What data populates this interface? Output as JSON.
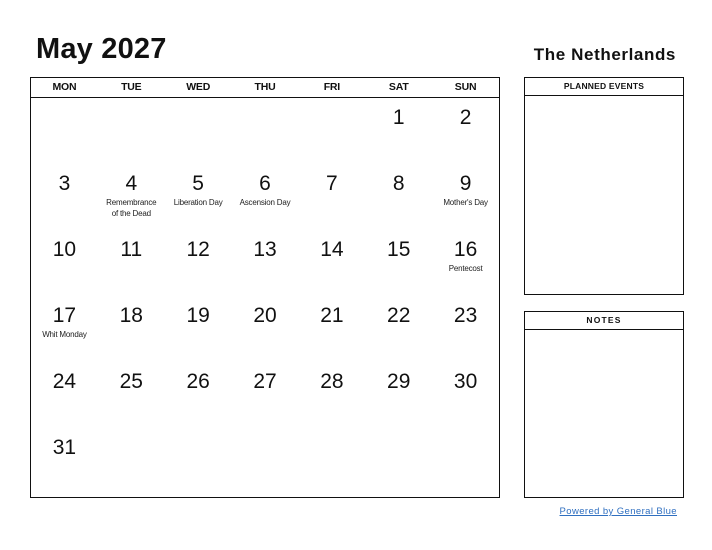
{
  "header": {
    "title": "May 2027",
    "country": "The Netherlands"
  },
  "calendar": {
    "weekdays": [
      "MON",
      "TUE",
      "WED",
      "THU",
      "FRI",
      "SAT",
      "SUN"
    ],
    "weeks": [
      [
        {
          "day": "",
          "holiday": ""
        },
        {
          "day": "",
          "holiday": ""
        },
        {
          "day": "",
          "holiday": ""
        },
        {
          "day": "",
          "holiday": ""
        },
        {
          "day": "",
          "holiday": ""
        },
        {
          "day": "1",
          "holiday": ""
        },
        {
          "day": "2",
          "holiday": ""
        }
      ],
      [
        {
          "day": "3",
          "holiday": ""
        },
        {
          "day": "4",
          "holiday": "Remembrance of the Dead"
        },
        {
          "day": "5",
          "holiday": "Liberation Day"
        },
        {
          "day": "6",
          "holiday": "Ascension Day"
        },
        {
          "day": "7",
          "holiday": ""
        },
        {
          "day": "8",
          "holiday": ""
        },
        {
          "day": "9",
          "holiday": "Mother's Day"
        }
      ],
      [
        {
          "day": "10",
          "holiday": ""
        },
        {
          "day": "11",
          "holiday": ""
        },
        {
          "day": "12",
          "holiday": ""
        },
        {
          "day": "13",
          "holiday": ""
        },
        {
          "day": "14",
          "holiday": ""
        },
        {
          "day": "15",
          "holiday": ""
        },
        {
          "day": "16",
          "holiday": "Pentecost"
        }
      ],
      [
        {
          "day": "17",
          "holiday": "Whit Monday"
        },
        {
          "day": "18",
          "holiday": ""
        },
        {
          "day": "19",
          "holiday": ""
        },
        {
          "day": "20",
          "holiday": ""
        },
        {
          "day": "21",
          "holiday": ""
        },
        {
          "day": "22",
          "holiday": ""
        },
        {
          "day": "23",
          "holiday": ""
        }
      ],
      [
        {
          "day": "24",
          "holiday": ""
        },
        {
          "day": "25",
          "holiday": ""
        },
        {
          "day": "26",
          "holiday": ""
        },
        {
          "day": "27",
          "holiday": ""
        },
        {
          "day": "28",
          "holiday": ""
        },
        {
          "day": "29",
          "holiday": ""
        },
        {
          "day": "30",
          "holiday": ""
        }
      ],
      [
        {
          "day": "31",
          "holiday": ""
        },
        {
          "day": "",
          "holiday": ""
        },
        {
          "day": "",
          "holiday": ""
        },
        {
          "day": "",
          "holiday": ""
        },
        {
          "day": "",
          "holiday": ""
        },
        {
          "day": "",
          "holiday": ""
        },
        {
          "day": "",
          "holiday": ""
        }
      ]
    ]
  },
  "panels": {
    "events_title": "PLANNED EVENTS",
    "notes_title": "NOTES"
  },
  "footer": {
    "powered_by": "Powered by General Blue",
    "link_color": "#2f6fc0"
  }
}
